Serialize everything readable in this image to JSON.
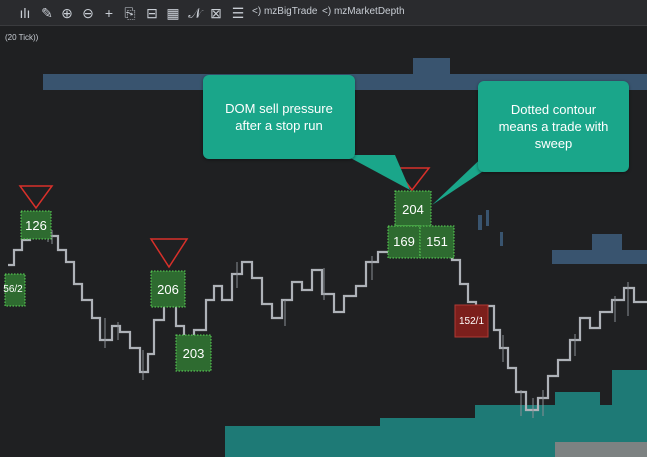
{
  "toolbar": {
    "items": [
      {
        "name": "bar-chart-icon",
        "glyph": "ılı"
      },
      {
        "name": "draw-line-icon",
        "glyph": "✎"
      },
      {
        "name": "zoom-in-icon",
        "glyph": "⊕"
      },
      {
        "name": "zoom-out-icon",
        "glyph": "⊖"
      },
      {
        "name": "crosshair-icon",
        "glyph": "+"
      },
      {
        "name": "export-icon",
        "glyph": "⎘"
      },
      {
        "name": "price-marker-icon",
        "glyph": "⊟"
      },
      {
        "name": "indicator-panel-icon",
        "glyph": "▦"
      },
      {
        "name": "study-icon",
        "glyph": "𝒩"
      },
      {
        "name": "template-icon",
        "glyph": "⊠"
      },
      {
        "name": "list-icon",
        "glyph": "☰"
      }
    ],
    "studies": [
      "<) mzBigTrade",
      "<) mzMarketDepth"
    ]
  },
  "chart": {
    "tick_label": "(20 Tick))",
    "callouts": [
      {
        "text": "DOM sell pressure after a stop run"
      },
      {
        "text": "Dotted contour means a trade with sweep"
      }
    ],
    "trades": [
      {
        "label": "126",
        "side": "buy"
      },
      {
        "label": "56/2",
        "side": "buy"
      },
      {
        "label": "206",
        "side": "buy"
      },
      {
        "label": "203",
        "side": "buy"
      },
      {
        "label": "204",
        "side": "buy"
      },
      {
        "label": "169",
        "side": "buy"
      },
      {
        "label": "151",
        "side": "buy"
      },
      {
        "label": "152/1",
        "side": "sell"
      }
    ]
  },
  "colors": {
    "background": "#1f2022",
    "buy_fill": "#2e6b30",
    "buy_border": "#5fd85a",
    "sell_fill": "#7c1f1c",
    "depth_blue": "#3c5a78",
    "depth_teal": "#1e7a76",
    "callout": "#1aa68a",
    "marker_red": "#d8302a"
  }
}
